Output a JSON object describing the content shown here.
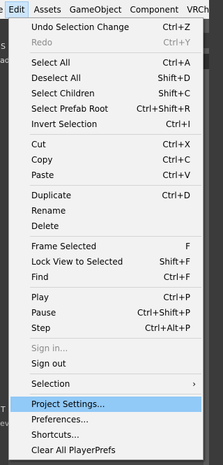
{
  "menubar": {
    "items": [
      "e",
      "Edit",
      "Assets",
      "GameObject",
      "Component",
      "VRChat S"
    ]
  },
  "background": {
    "left_tags": [
      "S",
      "ad",
      "T",
      "ev"
    ]
  },
  "menu": {
    "groups": [
      [
        {
          "label": "Undo Selection Change",
          "shortcut": "Ctrl+Z"
        },
        {
          "label": "Redo",
          "shortcut": "Ctrl+Y",
          "disabled": true
        }
      ],
      [
        {
          "label": "Select All",
          "shortcut": "Ctrl+A"
        },
        {
          "label": "Deselect All",
          "shortcut": "Shift+D"
        },
        {
          "label": "Select Children",
          "shortcut": "Shift+C"
        },
        {
          "label": "Select Prefab Root",
          "shortcut": "Ctrl+Shift+R"
        },
        {
          "label": "Invert Selection",
          "shortcut": "Ctrl+I"
        }
      ],
      [
        {
          "label": "Cut",
          "shortcut": "Ctrl+X"
        },
        {
          "label": "Copy",
          "shortcut": "Ctrl+C"
        },
        {
          "label": "Paste",
          "shortcut": "Ctrl+V"
        }
      ],
      [
        {
          "label": "Duplicate",
          "shortcut": "Ctrl+D"
        },
        {
          "label": "Rename",
          "shortcut": ""
        },
        {
          "label": "Delete",
          "shortcut": ""
        }
      ],
      [
        {
          "label": "Frame Selected",
          "shortcut": "F"
        },
        {
          "label": "Lock View to Selected",
          "shortcut": "Shift+F"
        },
        {
          "label": "Find",
          "shortcut": "Ctrl+F"
        }
      ],
      [
        {
          "label": "Play",
          "shortcut": "Ctrl+P"
        },
        {
          "label": "Pause",
          "shortcut": "Ctrl+Shift+P"
        },
        {
          "label": "Step",
          "shortcut": "Ctrl+Alt+P"
        }
      ],
      [
        {
          "label": "Sign in...",
          "shortcut": "",
          "disabled": true
        },
        {
          "label": "Sign out",
          "shortcut": ""
        }
      ],
      [
        {
          "label": "Selection",
          "shortcut": "",
          "submenu": true,
          "arrow": "›"
        }
      ],
      [
        {
          "label": "Project Settings...",
          "shortcut": "",
          "highlighted": true
        },
        {
          "label": "Preferences...",
          "shortcut": ""
        },
        {
          "label": "Shortcuts...",
          "shortcut": ""
        },
        {
          "label": "Clear All PlayerPrefs",
          "shortcut": ""
        }
      ]
    ]
  },
  "colors": {
    "highlight": "#91c9f7",
    "menu_bg": "#f2f2f2",
    "menubar_active": "#cce5fb"
  }
}
